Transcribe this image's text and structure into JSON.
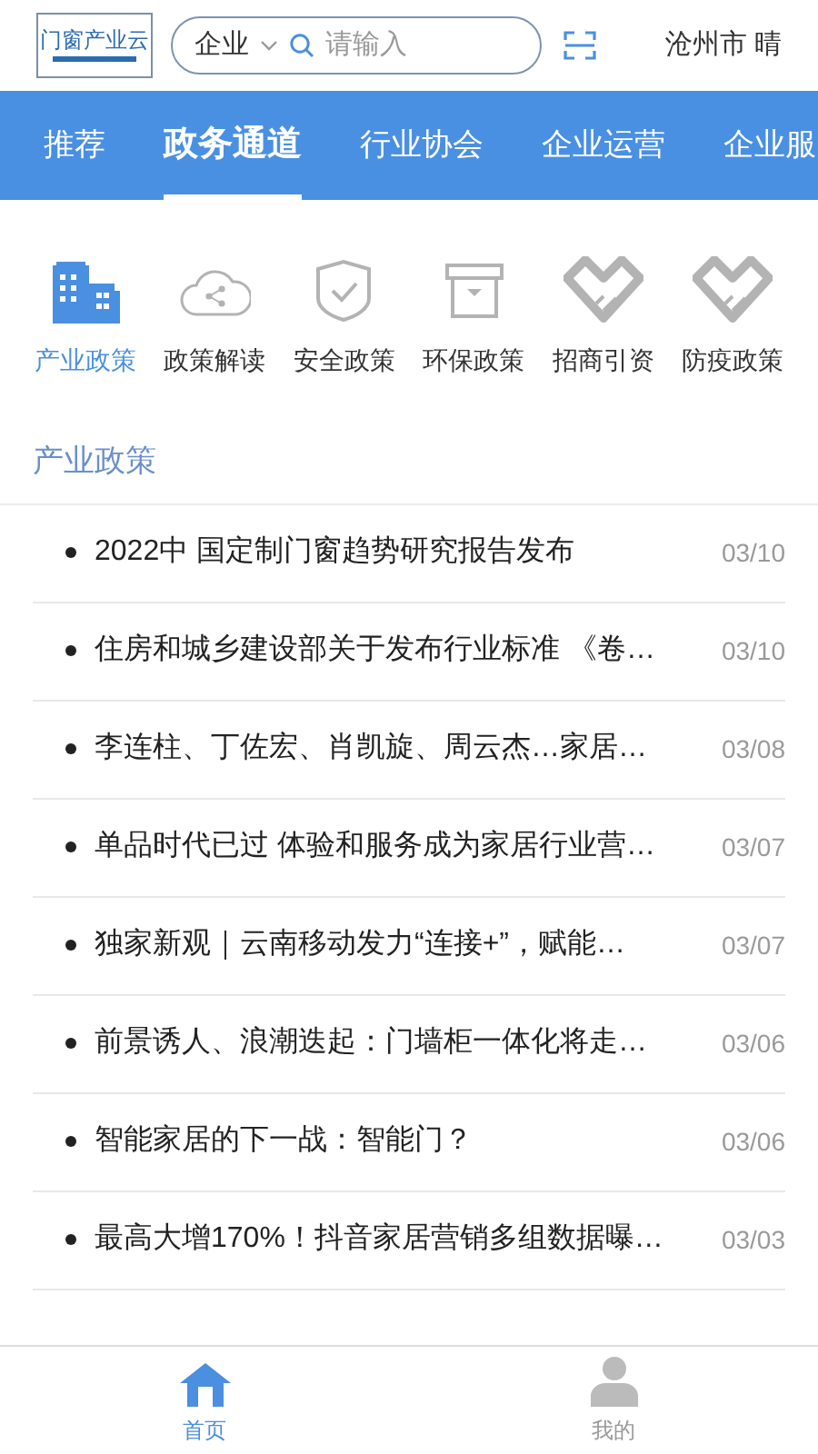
{
  "header": {
    "logo": "门窗产业云",
    "search": {
      "scope": "企业",
      "placeholder": "请输入"
    },
    "location": "沧州市 晴"
  },
  "tabs": [
    {
      "label": "推荐",
      "selected": false
    },
    {
      "label": "政务通道",
      "selected": true
    },
    {
      "label": "行业协会",
      "selected": false
    },
    {
      "label": "企业运营",
      "selected": false
    },
    {
      "label": "企业服",
      "selected": false
    }
  ],
  "categories": [
    {
      "label": "产业政策",
      "kind": "buildings",
      "selected": true
    },
    {
      "label": "政策解读",
      "kind": "cloud",
      "selected": false
    },
    {
      "label": "安全政策",
      "kind": "shield",
      "selected": false
    },
    {
      "label": "环保政策",
      "kind": "box",
      "selected": false
    },
    {
      "label": "招商引资",
      "kind": "handshake",
      "selected": false
    },
    {
      "label": "防疫政策",
      "kind": "handshake",
      "selected": false
    }
  ],
  "section_title": "产业政策",
  "news": [
    {
      "title": "2022中 国定制门窗趋势研究报告发布",
      "date": "03/10"
    },
    {
      "title": "住房和城乡建设部关于发布行业标准 《卷…",
      "date": "03/10"
    },
    {
      "title": "李连柱、丁佐宏、肖凯旋、周云杰…家居…",
      "date": "03/08"
    },
    {
      "title": "单品时代已过 体验和服务成为家居行业营…",
      "date": "03/07"
    },
    {
      "title": "独家新观｜云南移动发力“连接+”，赋能…",
      "date": "03/07"
    },
    {
      "title": "前景诱人、浪潮迭起：门墙柜一体化将走…",
      "date": "03/06"
    },
    {
      "title": "智能家居的下一战：智能门？",
      "date": "03/06"
    },
    {
      "title": "最高大增170%！抖音家居营销多组数据曝…",
      "date": "03/03"
    }
  ],
  "bottom_nav": [
    {
      "label": "首页",
      "kind": "home",
      "selected": true
    },
    {
      "label": "我的",
      "kind": "user",
      "selected": false
    }
  ]
}
